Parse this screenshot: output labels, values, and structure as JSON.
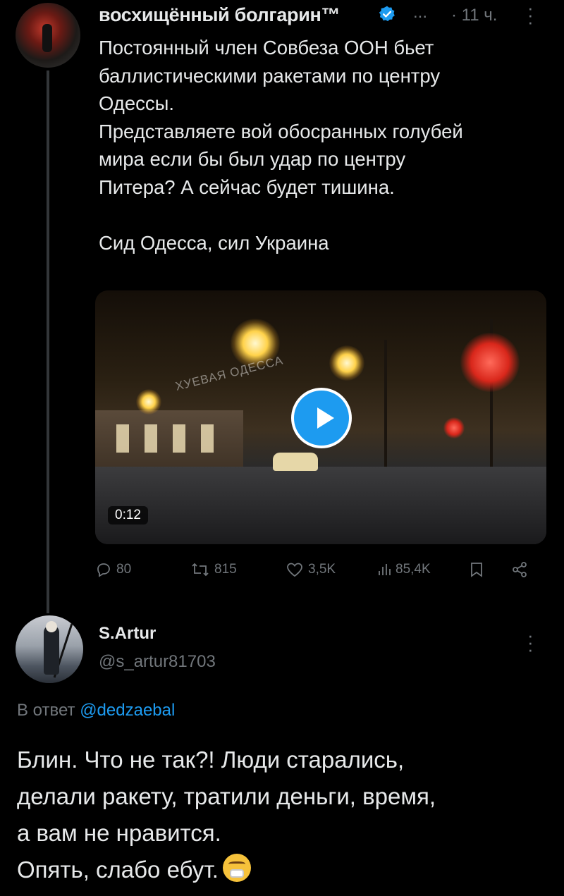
{
  "tweet1": {
    "display_name": "восхищённый болгарин™",
    "ellipsis": "...",
    "time": "· 11 ч.",
    "text_lines": [
      "Постоянный член Совбеза ООН бьет",
      "баллистическими ракетами по центру",
      "Одессы.",
      "Представляете вой обосранных голубей",
      "мира если бы был удар по центру",
      "Питера? А сейчас будет тишина.",
      "Сид Одесса, сил Украина"
    ],
    "video": {
      "duration": "0:12",
      "watermark": "ХУЕВАЯ ОДЕССА"
    },
    "stats": {
      "replies": "80",
      "retweets": "815",
      "likes": "3,5K",
      "views": "85,4K"
    }
  },
  "tweet2": {
    "display_name": "S.Artur",
    "handle": "@s_artur81703",
    "reply_prefix": "В ответ",
    "reply_mention": "@dedzaebal",
    "text_lines": [
      "Блин. Что не так?! Люди старались,",
      "делали ракету, тратили деньги, время,",
      "а вам не нравится.",
      "Опять, слабо ебут."
    ],
    "emoji": "sneezing-face"
  },
  "colors": {
    "background": "#000000",
    "text_primary": "#e7e9ea",
    "text_secondary": "#71767b",
    "accent": "#1d9bf0"
  }
}
